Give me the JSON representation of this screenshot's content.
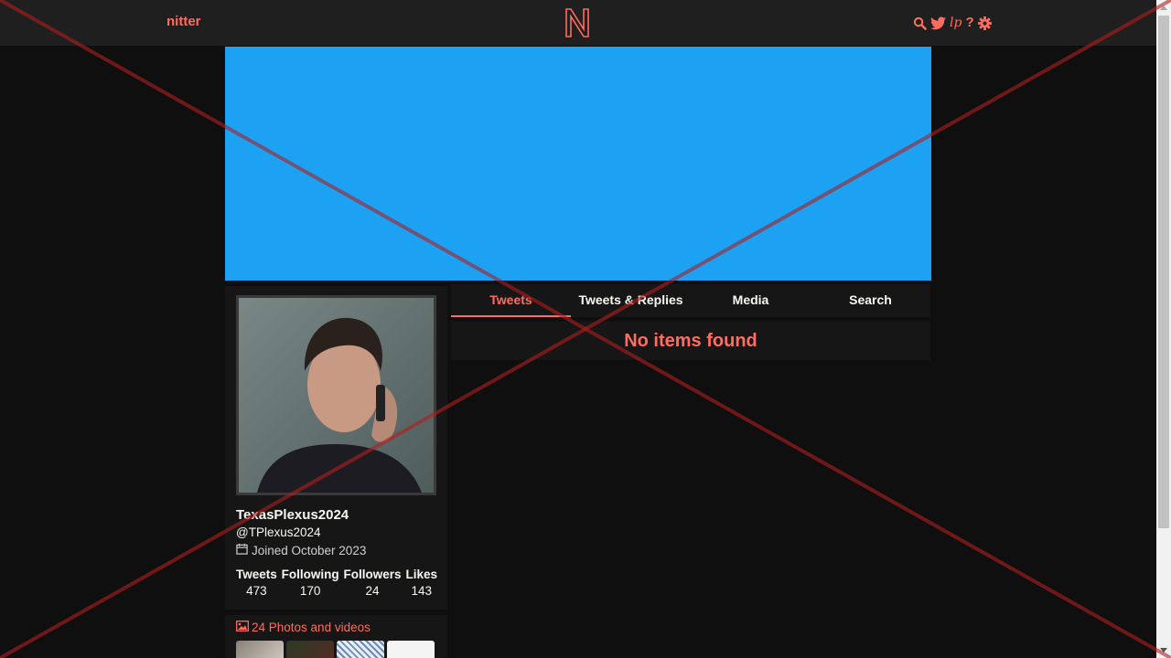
{
  "navbar": {
    "brand": "nitter",
    "logo_letter": "N",
    "icons": [
      "search-icon",
      "twitter-bird-icon",
      "lp-icon",
      "help-icon",
      "settings-icon"
    ],
    "lp_text": "lp",
    "help_text": "?"
  },
  "banner": {
    "color": "#1da1f2"
  },
  "profile": {
    "fullname": "TexasPlexus2024",
    "username": "@TPlexus2024",
    "joined": "Joined October 2023",
    "stats": [
      {
        "label": "Tweets",
        "value": "473"
      },
      {
        "label": "Following",
        "value": "170"
      },
      {
        "label": "Followers",
        "value": "24"
      },
      {
        "label": "Likes",
        "value": "143"
      }
    ]
  },
  "photo_rail": {
    "header": "24 Photos and videos"
  },
  "tabs": [
    {
      "label": "Tweets",
      "active": true
    },
    {
      "label": "Tweets & Replies",
      "active": false
    },
    {
      "label": "Media",
      "active": false
    },
    {
      "label": "Search",
      "active": false
    }
  ],
  "timeline": {
    "empty_message": "No items found"
  },
  "colors": {
    "accent": "#ff6c60",
    "background": "#0f0f0f",
    "panel": "#161616",
    "navbar": "#1f1f1f"
  }
}
